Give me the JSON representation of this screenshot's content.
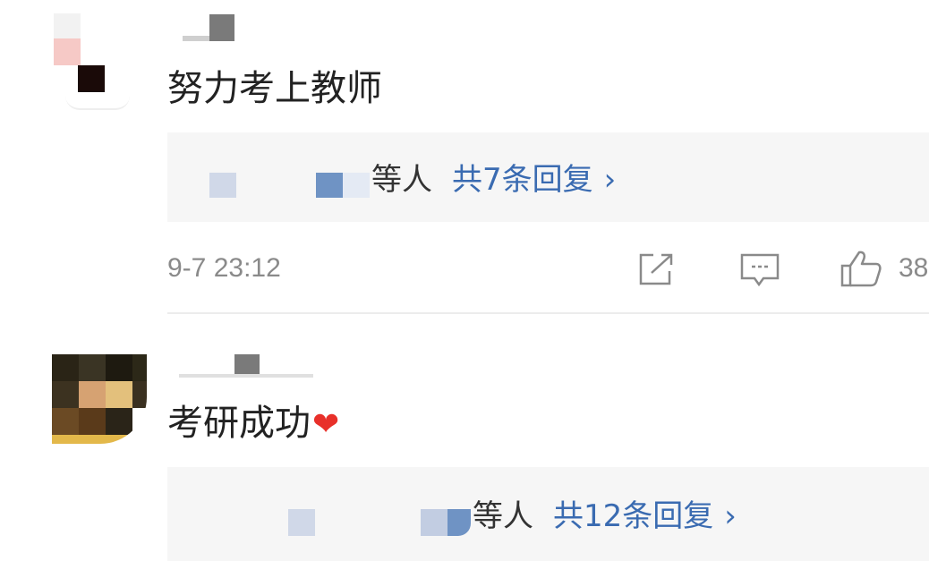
{
  "comments": [
    {
      "text": "努力考上教师",
      "reply_suffix": "等人",
      "reply_count_label": "共7条回复",
      "chevron": "›",
      "time": "9-7 23:12",
      "like_count": "38",
      "actions": [
        "share-icon",
        "comment-icon",
        "thumbs-up-icon"
      ]
    },
    {
      "text": "考研成功",
      "emoji": "❤",
      "reply_suffix": "等人",
      "reply_count_label": "共12条回复",
      "chevron": "›"
    }
  ],
  "colors": {
    "link": "#3a6bb1",
    "meta": "#8a8a8a",
    "reply_bg": "#f6f6f6",
    "heart": "#e8302a"
  }
}
